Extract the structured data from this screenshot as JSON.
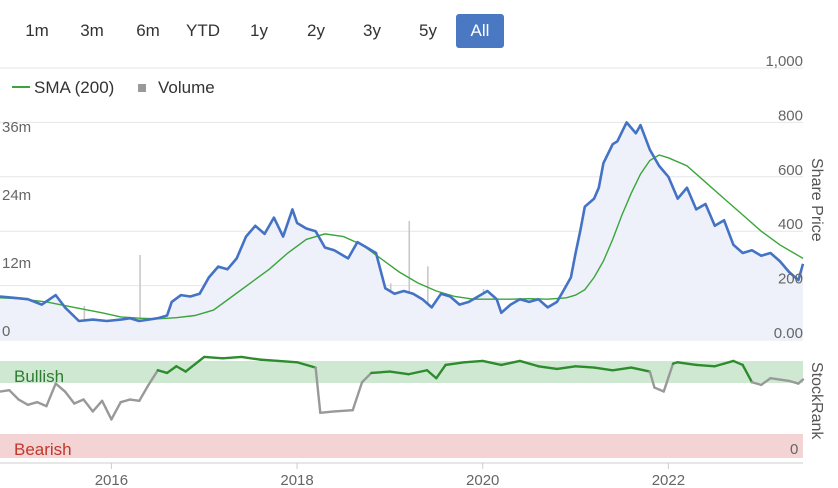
{
  "range_selector": {
    "buttons": [
      "1m",
      "3m",
      "6m",
      "YTD",
      "1y",
      "2y",
      "3y",
      "5y",
      "All"
    ],
    "active": "All"
  },
  "legend": {
    "sma_label": "SMA (200)",
    "volume_label": "Volume"
  },
  "colors": {
    "price": "#4472c4",
    "price_fill": "#eef1fa",
    "sma": "#3aa53a",
    "volume": "#c8c8c8",
    "stockrank_bull": "#2e8b2e",
    "stockrank_neutral": "#999999",
    "bullish_band": "#cfe8d2",
    "bearish_band": "#f3d3d3",
    "bullish_text": "#2e7d32",
    "bearish_text": "#c0392b",
    "active_button": "#4a78c2"
  },
  "chart_data": [
    {
      "type": "line",
      "title": "",
      "ylabel": "Share Price",
      "ylim": [
        0,
        1000
      ],
      "y_ticks": [
        "1,000",
        "800",
        "600",
        "400",
        "200",
        "0.00"
      ],
      "volume_ticks": [
        "36m",
        "24m",
        "12m",
        "0"
      ],
      "volume_lim": [
        0,
        48
      ],
      "x_ticks": [
        "2016",
        "2018",
        "2020",
        "2022"
      ],
      "xlim": [
        2014.8,
        2023.45
      ],
      "series": [
        {
          "name": "Price",
          "x": [
            2014.8,
            2014.95,
            2015.1,
            2015.25,
            2015.4,
            2015.5,
            2015.65,
            2015.8,
            2015.95,
            2016.1,
            2016.2,
            2016.3,
            2016.4,
            2016.5,
            2016.6,
            2016.65,
            2016.75,
            2016.85,
            2016.95,
            2017.05,
            2017.15,
            2017.25,
            2017.35,
            2017.45,
            2017.55,
            2017.65,
            2017.75,
            2017.85,
            2017.95,
            2018.0,
            2018.1,
            2018.2,
            2018.3,
            2018.4,
            2018.5,
            2018.55,
            2018.65,
            2018.75,
            2018.85,
            2018.95,
            2019.05,
            2019.15,
            2019.25,
            2019.35,
            2019.45,
            2019.55,
            2019.65,
            2019.75,
            2019.85,
            2019.95,
            2020.05,
            2020.15,
            2020.2,
            2020.3,
            2020.4,
            2020.5,
            2020.6,
            2020.7,
            2020.8,
            2020.9,
            2020.95,
            2021.0,
            2021.05,
            2021.1,
            2021.2,
            2021.25,
            2021.3,
            2021.4,
            2021.45,
            2021.55,
            2021.65,
            2021.7,
            2021.8,
            2021.9,
            2022.0,
            2022.1,
            2022.2,
            2022.3,
            2022.4,
            2022.5,
            2022.6,
            2022.7,
            2022.8,
            2022.9,
            2023.0,
            2023.1,
            2023.2,
            2023.3,
            2023.4,
            2023.45
          ],
          "values": [
            160,
            155,
            150,
            130,
            165,
            120,
            70,
            75,
            70,
            75,
            80,
            70,
            75,
            80,
            90,
            140,
            165,
            160,
            170,
            230,
            270,
            260,
            300,
            380,
            420,
            390,
            450,
            380,
            480,
            430,
            410,
            400,
            340,
            330,
            310,
            300,
            360,
            340,
            320,
            190,
            170,
            180,
            170,
            150,
            120,
            170,
            160,
            130,
            140,
            160,
            180,
            150,
            100,
            130,
            150,
            140,
            150,
            120,
            140,
            200,
            230,
            320,
            400,
            490,
            520,
            560,
            650,
            720,
            730,
            800,
            760,
            790,
            700,
            640,
            600,
            520,
            560,
            480,
            500,
            420,
            440,
            350,
            320,
            330,
            310,
            320,
            290,
            250,
            220,
            280
          ]
        },
        {
          "name": "SMA (200)",
          "x": [
            2014.8,
            2015.0,
            2015.3,
            2015.6,
            2015.9,
            2016.1,
            2016.3,
            2016.5,
            2016.7,
            2016.9,
            2017.1,
            2017.3,
            2017.5,
            2017.7,
            2017.9,
            2018.1,
            2018.3,
            2018.5,
            2018.7,
            2018.9,
            2019.1,
            2019.3,
            2019.5,
            2019.7,
            2019.9,
            2020.1,
            2020.3,
            2020.5,
            2020.7,
            2020.9,
            2021.0,
            2021.1,
            2021.2,
            2021.3,
            2021.4,
            2021.5,
            2021.6,
            2021.7,
            2021.8,
            2021.9,
            2022.0,
            2022.2,
            2022.4,
            2022.6,
            2022.8,
            2023.0,
            2023.2,
            2023.4,
            2023.45
          ],
          "values": [
            155,
            152,
            140,
            120,
            100,
            85,
            80,
            78,
            82,
            90,
            110,
            160,
            210,
            260,
            320,
            370,
            390,
            380,
            350,
            300,
            250,
            210,
            180,
            160,
            150,
            150,
            150,
            152,
            150,
            155,
            165,
            185,
            230,
            290,
            370,
            460,
            540,
            610,
            660,
            680,
            670,
            640,
            580,
            520,
            460,
            400,
            350,
            310,
            300
          ]
        },
        {
          "name": "Volume",
          "x": [
            2015.3,
            2015.7,
            2016.0,
            2016.3,
            2016.6,
            2016.9,
            2017.2,
            2017.5,
            2017.8,
            2018.1,
            2018.4,
            2018.7,
            2019.0,
            2019.2,
            2019.4,
            2019.6,
            2019.8,
            2020.0,
            2020.3,
            2020.6,
            2020.9,
            2021.2,
            2021.5,
            2021.8,
            2022.1,
            2022.4,
            2022.7,
            2022.9,
            2023.1,
            2023.3
          ],
          "values": [
            2,
            6,
            3,
            15,
            4,
            3,
            2,
            5,
            4,
            12,
            6,
            8,
            10,
            21,
            13,
            6,
            5,
            9,
            5,
            6,
            7,
            6,
            8,
            9,
            7,
            6,
            10,
            12,
            7,
            5
          ]
        }
      ]
    },
    {
      "type": "line",
      "title": "",
      "ylabel": "StockRank",
      "ylim": [
        0,
        100
      ],
      "y_ticks": [
        "0"
      ],
      "bands": [
        "Bullish",
        "Bearish"
      ],
      "xlim": [
        2014.8,
        2023.45
      ],
      "series": [
        {
          "name": "StockRank",
          "x": [
            2014.8,
            2014.9,
            2015.0,
            2015.1,
            2015.2,
            2015.3,
            2015.4,
            2015.5,
            2015.6,
            2015.7,
            2015.8,
            2015.9,
            2016.0,
            2016.1,
            2016.2,
            2016.3,
            2016.4,
            2016.5,
            2016.6,
            2016.7,
            2016.8,
            2017.0,
            2017.2,
            2017.4,
            2017.6,
            2017.8,
            2018.0,
            2018.2,
            2018.25,
            2018.4,
            2018.6,
            2018.7,
            2018.8,
            2019.0,
            2019.2,
            2019.4,
            2019.5,
            2019.6,
            2019.8,
            2020.0,
            2020.2,
            2020.4,
            2020.6,
            2020.8,
            2021.0,
            2021.2,
            2021.4,
            2021.6,
            2021.8,
            2021.85,
            2021.95,
            2022.05,
            2022.1,
            2022.3,
            2022.5,
            2022.6,
            2022.7,
            2022.8,
            2022.9,
            2023.0,
            2023.1,
            2023.2,
            2023.3,
            2023.4,
            2023.45
          ],
          "values": [
            60,
            62,
            48,
            40,
            44,
            38,
            72,
            60,
            42,
            48,
            30,
            46,
            18,
            44,
            48,
            46,
            70,
            92,
            88,
            98,
            90,
            112,
            110,
            112,
            108,
            106,
            104,
            96,
            28,
            30,
            32,
            74,
            88,
            90,
            86,
            92,
            80,
            100,
            104,
            106,
            100,
            106,
            98,
            94,
            98,
            96,
            92,
            96,
            90,
            66,
            60,
            102,
            104,
            100,
            98,
            102,
            106,
            100,
            74,
            70,
            80,
            78,
            76,
            72,
            78
          ]
        }
      ]
    }
  ]
}
